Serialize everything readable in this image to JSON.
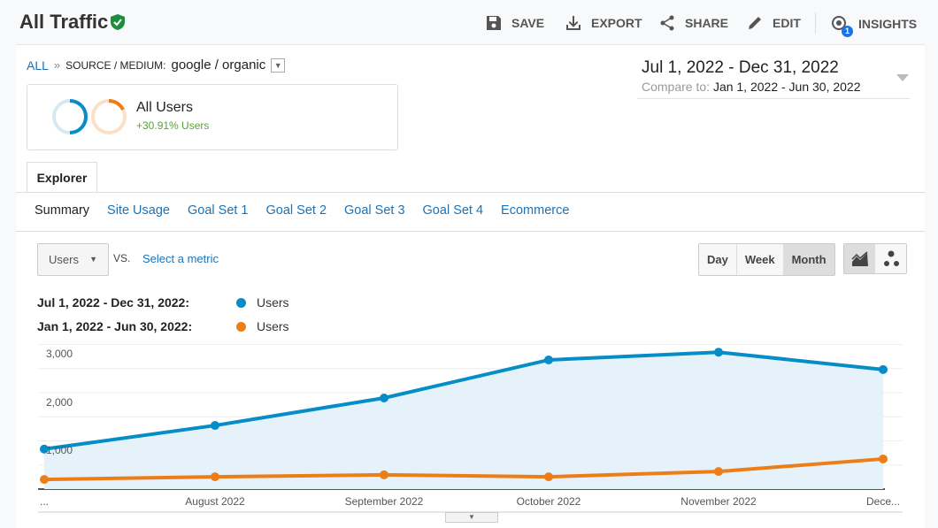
{
  "header": {
    "title": "All Traffic",
    "verified_icon": "shield-check-icon",
    "toolbar": [
      {
        "label": "SAVE",
        "icon": "save-icon"
      },
      {
        "label": "EXPORT",
        "icon": "download-icon"
      },
      {
        "label": "SHARE",
        "icon": "share-icon"
      },
      {
        "label": "EDIT",
        "icon": "pencil-icon"
      },
      {
        "label": "INSIGHTS",
        "icon": "insights-icon",
        "badge": "1"
      }
    ]
  },
  "breadcrumb": {
    "root": "ALL",
    "sep": "»",
    "dimension": "SOURCE / MEDIUM:",
    "value": "google / organic"
  },
  "segment": {
    "name": "All Users",
    "change": "+30.91% Users"
  },
  "date_range": {
    "primary": "Jul 1, 2022 - Dec 31, 2022",
    "compare_label": "Compare to:",
    "compare": "Jan 1, 2022 - Jun 30, 2022"
  },
  "tabs": {
    "active": "Explorer",
    "subtabs": [
      "Summary",
      "Site Usage",
      "Goal Set 1",
      "Goal Set 2",
      "Goal Set 3",
      "Goal Set 4",
      "Ecommerce"
    ]
  },
  "controls": {
    "metric": "Users",
    "vs": "VS.",
    "select_metric": "Select a metric",
    "periods": [
      "Day",
      "Week",
      "Month"
    ],
    "active_period": "Month"
  },
  "legend": [
    {
      "range": "Jul 1, 2022 - Dec 31, 2022:",
      "metric": "Users",
      "color": "#058dc7"
    },
    {
      "range": "Jan 1, 2022 - Jun 30, 2022:",
      "metric": "Users",
      "color": "#ed7e17"
    }
  ],
  "chart_data": {
    "type": "line",
    "categories": [
      "...",
      "August 2022",
      "September 2022",
      "October 2022",
      "November 2022",
      "Dece..."
    ],
    "y_ticks": [
      "3,000",
      "2,000",
      "1,000"
    ],
    "ylim": [
      0,
      3000
    ],
    "grid": true,
    "series": [
      {
        "name": "Users",
        "range": "Jul 1, 2022 - Dec 31, 2022",
        "color": "#058dc7",
        "area": true,
        "values": [
          830,
          1320,
          1890,
          2680,
          2840,
          2480
        ]
      },
      {
        "name": "Users",
        "range": "Jan 1, 2022 - Jun 30, 2022",
        "color": "#ed7e17",
        "values": [
          200,
          255,
          295,
          255,
          365,
          625
        ]
      }
    ]
  }
}
